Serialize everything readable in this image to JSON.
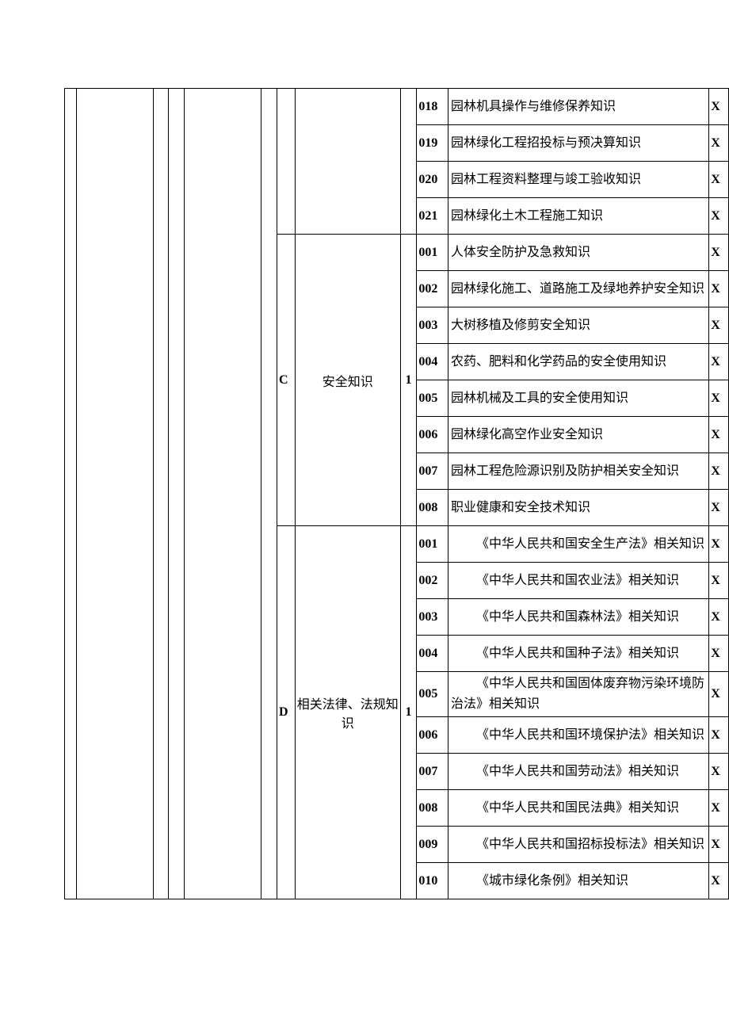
{
  "col_i_value": "1",
  "blocks": [
    {
      "letter": "",
      "title": "",
      "rows": [
        {
          "code": "018",
          "topic": "园林机具操作与维修保养知识",
          "x": "X",
          "indent": false
        },
        {
          "code": "019",
          "topic": "园林绿化工程招投标与预决算知识",
          "x": "X",
          "indent": false
        },
        {
          "code": "020",
          "topic": "园林工程资料整理与竣工验收知识",
          "x": "X",
          "indent": false
        },
        {
          "code": "021",
          "topic": "园林绿化土木工程施工知识",
          "x": "X",
          "indent": false
        }
      ]
    },
    {
      "letter": "C",
      "title": "安全知识",
      "rows": [
        {
          "code": "001",
          "topic": "人体安全防护及急救知识",
          "x": "X",
          "indent": false
        },
        {
          "code": "002",
          "topic": "园林绿化施工、道路施工及绿地养护安全知识",
          "x": "X",
          "indent": false
        },
        {
          "code": "003",
          "topic": "大树移植及修剪安全知识",
          "x": "X",
          "indent": false
        },
        {
          "code": "004",
          "topic": "农药、肥料和化学药品的安全使用知识",
          "x": "X",
          "indent": false
        },
        {
          "code": "005",
          "topic": "园林机械及工具的安全使用知识",
          "x": "X",
          "indent": false
        },
        {
          "code": "006",
          "topic": "园林绿化高空作业安全知识",
          "x": "X",
          "indent": false
        },
        {
          "code": "007",
          "topic": "园林工程危险源识别及防护相关安全知识",
          "x": "X",
          "indent": false
        },
        {
          "code": "008",
          "topic": "职业健康和安全技术知识",
          "x": "X",
          "indent": false
        }
      ]
    },
    {
      "letter": "D",
      "title": "相关法律、法规知识",
      "rows": [
        {
          "code": "001",
          "topic": "《中华人民共和国安全生产法》相关知识",
          "x": "X",
          "indent": true
        },
        {
          "code": "002",
          "topic": "《中华人民共和国农业法》相关知识",
          "x": "X",
          "indent": true
        },
        {
          "code": "003",
          "topic": "《中华人民共和国森林法》相关知识",
          "x": "X",
          "indent": true
        },
        {
          "code": "004",
          "topic": "《中华人民共和国种子法》相关知识",
          "x": "X",
          "indent": true
        },
        {
          "code": "005",
          "topic": "《中华人民共和国固体废弃物污染环境防治法》相关知识",
          "x": "X",
          "indent": true,
          "tall": true
        },
        {
          "code": "006",
          "topic": "《中华人民共和国环境保护法》相关知识",
          "x": "X",
          "indent": true
        },
        {
          "code": "007",
          "topic": "《中华人民共和国劳动法》相关知识",
          "x": "X",
          "indent": true
        },
        {
          "code": "008",
          "topic": "《中华人民共和国民法典》相关知识",
          "x": "X",
          "indent": true
        },
        {
          "code": "009",
          "topic": "《中华人民共和国招标投标法》相关知识",
          "x": "X",
          "indent": true
        },
        {
          "code": "010",
          "topic": "《城市绿化条例》相关知识",
          "x": "X",
          "indent": true
        }
      ]
    }
  ]
}
